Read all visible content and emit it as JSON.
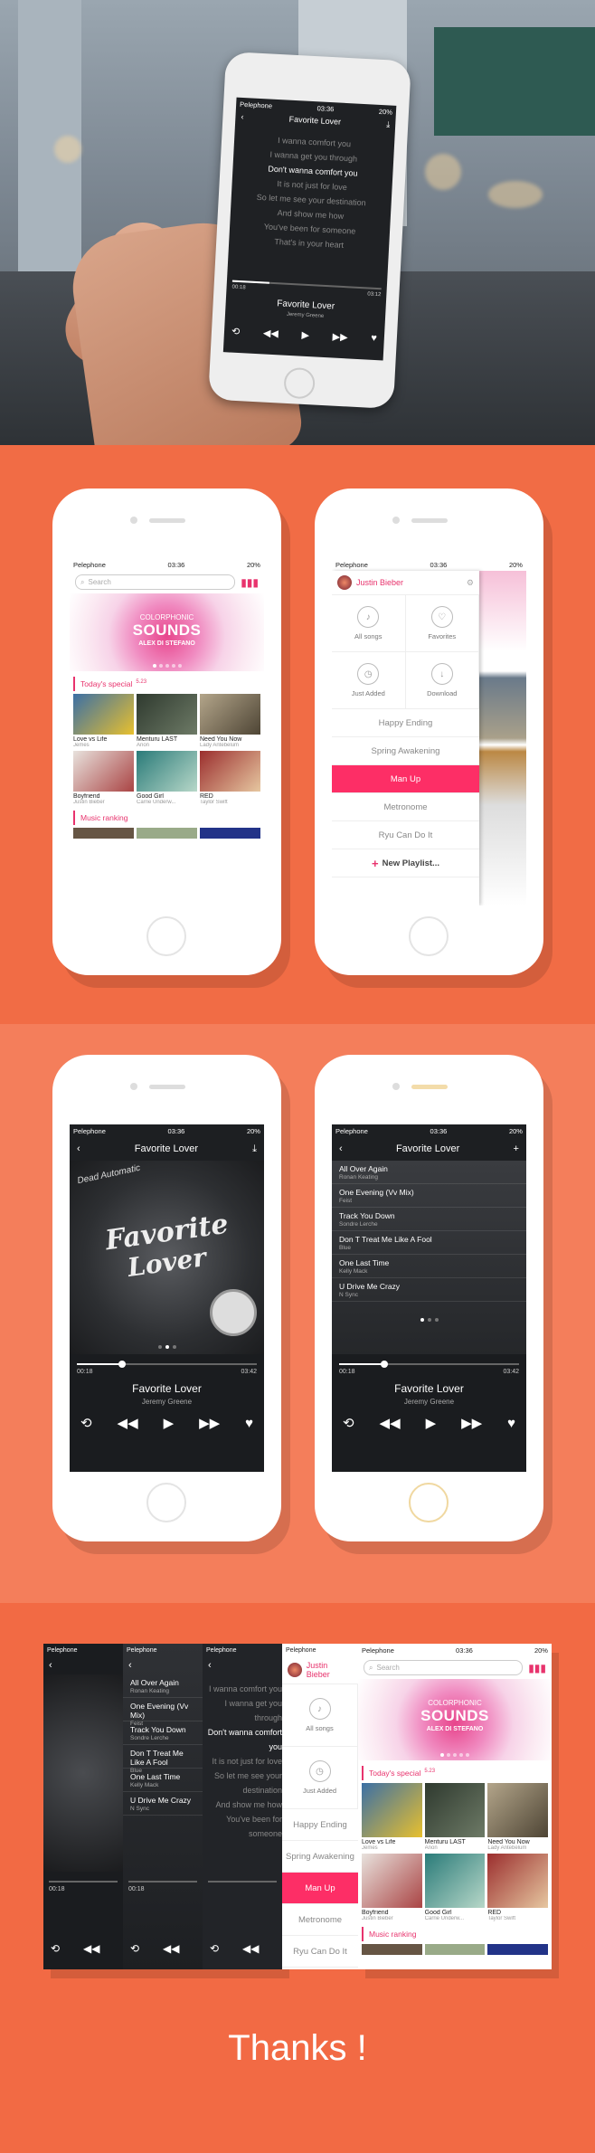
{
  "status": {
    "carrier": "Pelephone",
    "time": "03:36",
    "battery": "20%"
  },
  "hero": {
    "title": "Favorite Lover",
    "lyrics": [
      "I wanna comfort you",
      "I wanna get you through",
      "Don't wanna comfort you",
      "It is not just for love",
      "So let me see your destination",
      "And show me how",
      "You've been for someone",
      "That's in your heart"
    ],
    "time_start": "00:18",
    "time_end": "03:12",
    "song": "Favorite Lover",
    "artist": "Jeremy Greene"
  },
  "home": {
    "search_placeholder": "Search",
    "banner": {
      "line1": "COLORPHONIC",
      "line2": "SOUNDS",
      "line3": "ALEX DI STEFANO"
    },
    "today_label": "Today's special",
    "today_date": "5.23",
    "tiles": [
      {
        "title": "Love vs Life",
        "artist": "Jemes",
        "color": "#4a7fb0"
      },
      {
        "title": "Menturu LAST",
        "artist": "Anon",
        "color": "#3b4a3a"
      },
      {
        "title": "Need You Now",
        "artist": "Lady Antebelum",
        "color": "#8a7d6a"
      },
      {
        "title": "Boyfriend",
        "artist": "Justin Bieber",
        "color": "#c9c2bd"
      },
      {
        "title": "Good Girl",
        "artist": "Carrie Underw...",
        "color": "#3d8c8a"
      },
      {
        "title": "RED",
        "artist": "Taylor Swift",
        "color": "#7a2a2a"
      }
    ],
    "ranking_label": "Music ranking"
  },
  "drawer": {
    "user": "Justin Bieber",
    "cells": [
      {
        "label": "All songs",
        "icon": "music-note-icon"
      },
      {
        "label": "Favorites",
        "icon": "heart-icon"
      },
      {
        "label": "Just Added",
        "icon": "clock-icon"
      },
      {
        "label": "Download",
        "icon": "download-icon"
      }
    ],
    "playlists": [
      "Happy Ending",
      "Spring Awakening",
      "Man Up",
      "Metronome",
      "Ryu Can Do It"
    ],
    "active": "Man Up",
    "new_playlist": "New Playlist..."
  },
  "player": {
    "title": "Favorite Lover",
    "brand": "Dead Automatic",
    "cover_line1": "Favorite",
    "cover_line2": "Lover",
    "time_start": "00:18",
    "time_end": "03:42",
    "progress": 0.25,
    "song": "Favorite Lover",
    "artist": "Jeremy Greene"
  },
  "queue": [
    {
      "title": "All Over Again",
      "artist": "Ronan Keating"
    },
    {
      "title": "One Evening (Vv Mix)",
      "artist": "Feist"
    },
    {
      "title": "Track You Down",
      "artist": "Sondre Lerche"
    },
    {
      "title": "Don T Treat Me Like A Fool",
      "artist": "Blue"
    },
    {
      "title": "One Last Time",
      "artist": "Kelly Mack"
    },
    {
      "title": "U Drive Me Crazy",
      "artist": "N Sync"
    }
  ],
  "thanks": "Thanks !",
  "colors": {
    "accent": "#fd2e66",
    "bg": "#f07a55",
    "dark": "#1a1c1f"
  }
}
